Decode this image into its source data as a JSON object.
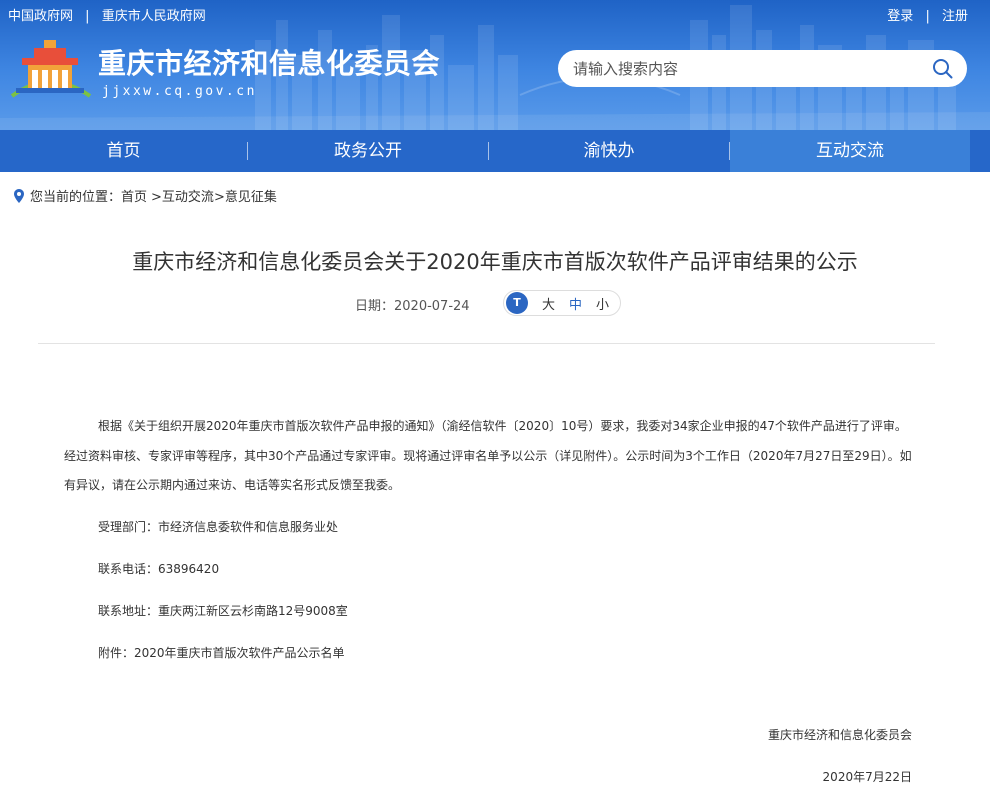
{
  "header": {
    "top_links": [
      "中国政府网",
      "重庆市人民政府网"
    ],
    "separator": "|",
    "user_links": [
      "登录",
      "注册"
    ],
    "site_title": "重庆市经济和信息化委员会",
    "site_url": "jjxxw.cq.gov.cn",
    "search": {
      "placeholder": "请输入搜索内容",
      "icon": "search-icon"
    }
  },
  "nav": {
    "items": [
      {
        "label": "首页"
      },
      {
        "label": "政务公开"
      },
      {
        "label": "渝快办"
      },
      {
        "label": "互动交流"
      }
    ],
    "active": "互动交流"
  },
  "breadcrumb": {
    "prefix": "您当前的位置：",
    "items": [
      "首页",
      ">互动交流",
      ">意见征集"
    ]
  },
  "article": {
    "title": "重庆市经济和信息化委员会关于2020年重庆市首版次软件产品评审结果的公示",
    "date_label": "日期：",
    "date": "2020-07-24",
    "font_size": {
      "icon_text": "T",
      "large": "大",
      "medium": "中",
      "small": "小"
    },
    "paragraph": "根据《关于组织开展2020年重庆市首版次软件产品申报的通知》（渝经信软件〔2020〕10号）要求，我委对34家企业申报的47个软件产品进行了评审。经过资料审核、专家评审等程序，其中30个产品通过专家评审。现将通过评审名单予以公示（详见附件）。公示时间为3个工作日（2020年7月27日至29日）。如有异议，请在公示期内通过来访、电话等实名形式反馈至我委。",
    "dept": "受理部门：市经济信息委软件和信息服务业处",
    "phone": "联系电话：63896420",
    "address": "联系地址：重庆两江新区云杉南路12号9008室",
    "attachment": "附件：2020年重庆市首版次软件产品公示名单",
    "signature": "重庆市经济和信息化委员会",
    "sign_date": "2020年7月22日"
  },
  "colors": {
    "nav_bg": "#2667c9",
    "nav_active": "#3a80d8",
    "accent": "#2b66c2"
  }
}
